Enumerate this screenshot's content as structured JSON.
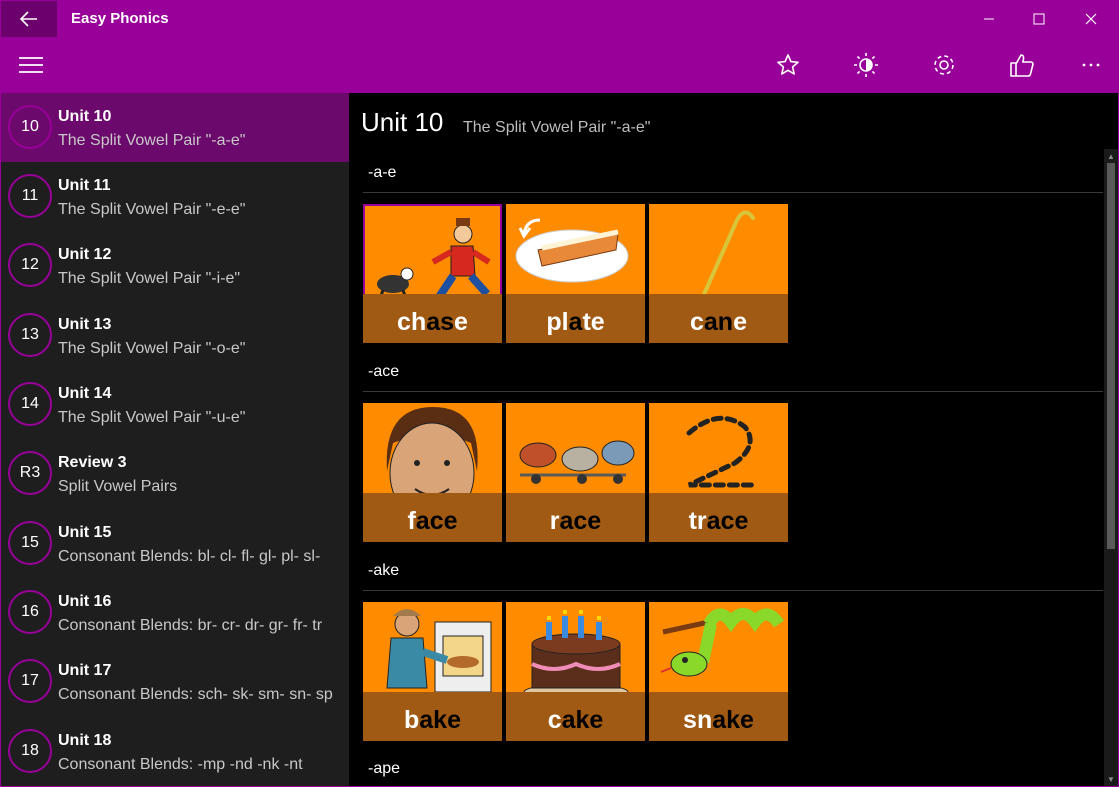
{
  "app": {
    "title": "Easy Phonics"
  },
  "colors": {
    "accent": "#990099",
    "selected": "#6c096c",
    "tile": "#ff8c00",
    "word_band": "#a05a14"
  },
  "icons": {
    "back": "back-arrow-icon",
    "menu": "hamburger-menu-icon",
    "star": "star-icon",
    "brightness": "brightness-icon",
    "settings": "gear-icon",
    "rate": "thumbs-up-icon",
    "more": "more-icon"
  },
  "sidebar": {
    "items": [
      {
        "num": "10",
        "title": "Unit 10",
        "subtitle": "The Split Vowel Pair \"-a-e\"",
        "selected": true
      },
      {
        "num": "11",
        "title": "Unit 11",
        "subtitle": "The Split Vowel Pair \"-e-e\""
      },
      {
        "num": "12",
        "title": "Unit 12",
        "subtitle": "The Split Vowel Pair \"-i-e\""
      },
      {
        "num": "13",
        "title": "Unit 13",
        "subtitle": "The Split Vowel Pair \"-o-e\""
      },
      {
        "num": "14",
        "title": "Unit 14",
        "subtitle": "The Split Vowel Pair \"-u-e\""
      },
      {
        "num": "R3",
        "title": "Review 3",
        "subtitle": "Split Vowel Pairs"
      },
      {
        "num": "15",
        "title": "Unit 15",
        "subtitle": "Consonant Blends: bl- cl- fl- gl- pl- sl-"
      },
      {
        "num": "16",
        "title": "Unit 16",
        "subtitle": "Consonant Blends: br- cr- dr- gr- fr- tr"
      },
      {
        "num": "17",
        "title": "Unit 17",
        "subtitle": "Consonant Blends: sch- sk- sm- sn- sp"
      },
      {
        "num": "18",
        "title": "Unit 18",
        "subtitle": "Consonant Blends: -mp -nd -nk -nt"
      }
    ]
  },
  "main": {
    "title": "Unit 10",
    "subtitle": "The Split Vowel Pair \"-a-e\"",
    "sections": [
      {
        "label": "-a-e",
        "words": [
          {
            "parts": [
              "ch",
              "as",
              "e"
            ],
            "picture": "running-man-goat"
          },
          {
            "parts": [
              "pl",
              "a",
              "te"
            ],
            "picture": "pie-on-plate"
          },
          {
            "parts": [
              "c",
              "an",
              "e"
            ],
            "picture": "walking-cane"
          }
        ]
      },
      {
        "label": "-ace",
        "words": [
          {
            "parts": [
              "f",
              "ace",
              ""
            ],
            "picture": "face"
          },
          {
            "parts": [
              "r",
              "ace",
              ""
            ],
            "picture": "animals-racing"
          },
          {
            "parts": [
              "tr",
              "ace",
              ""
            ],
            "picture": "traced-number-2"
          }
        ]
      },
      {
        "label": "-ake",
        "words": [
          {
            "parts": [
              "b",
              "ake",
              ""
            ],
            "picture": "baker-oven"
          },
          {
            "parts": [
              "c",
              "ake",
              ""
            ],
            "picture": "birthday-cake"
          },
          {
            "parts": [
              "sn",
              "ake",
              ""
            ],
            "picture": "green-snake"
          }
        ]
      },
      {
        "label": "-ape",
        "words": []
      }
    ]
  }
}
